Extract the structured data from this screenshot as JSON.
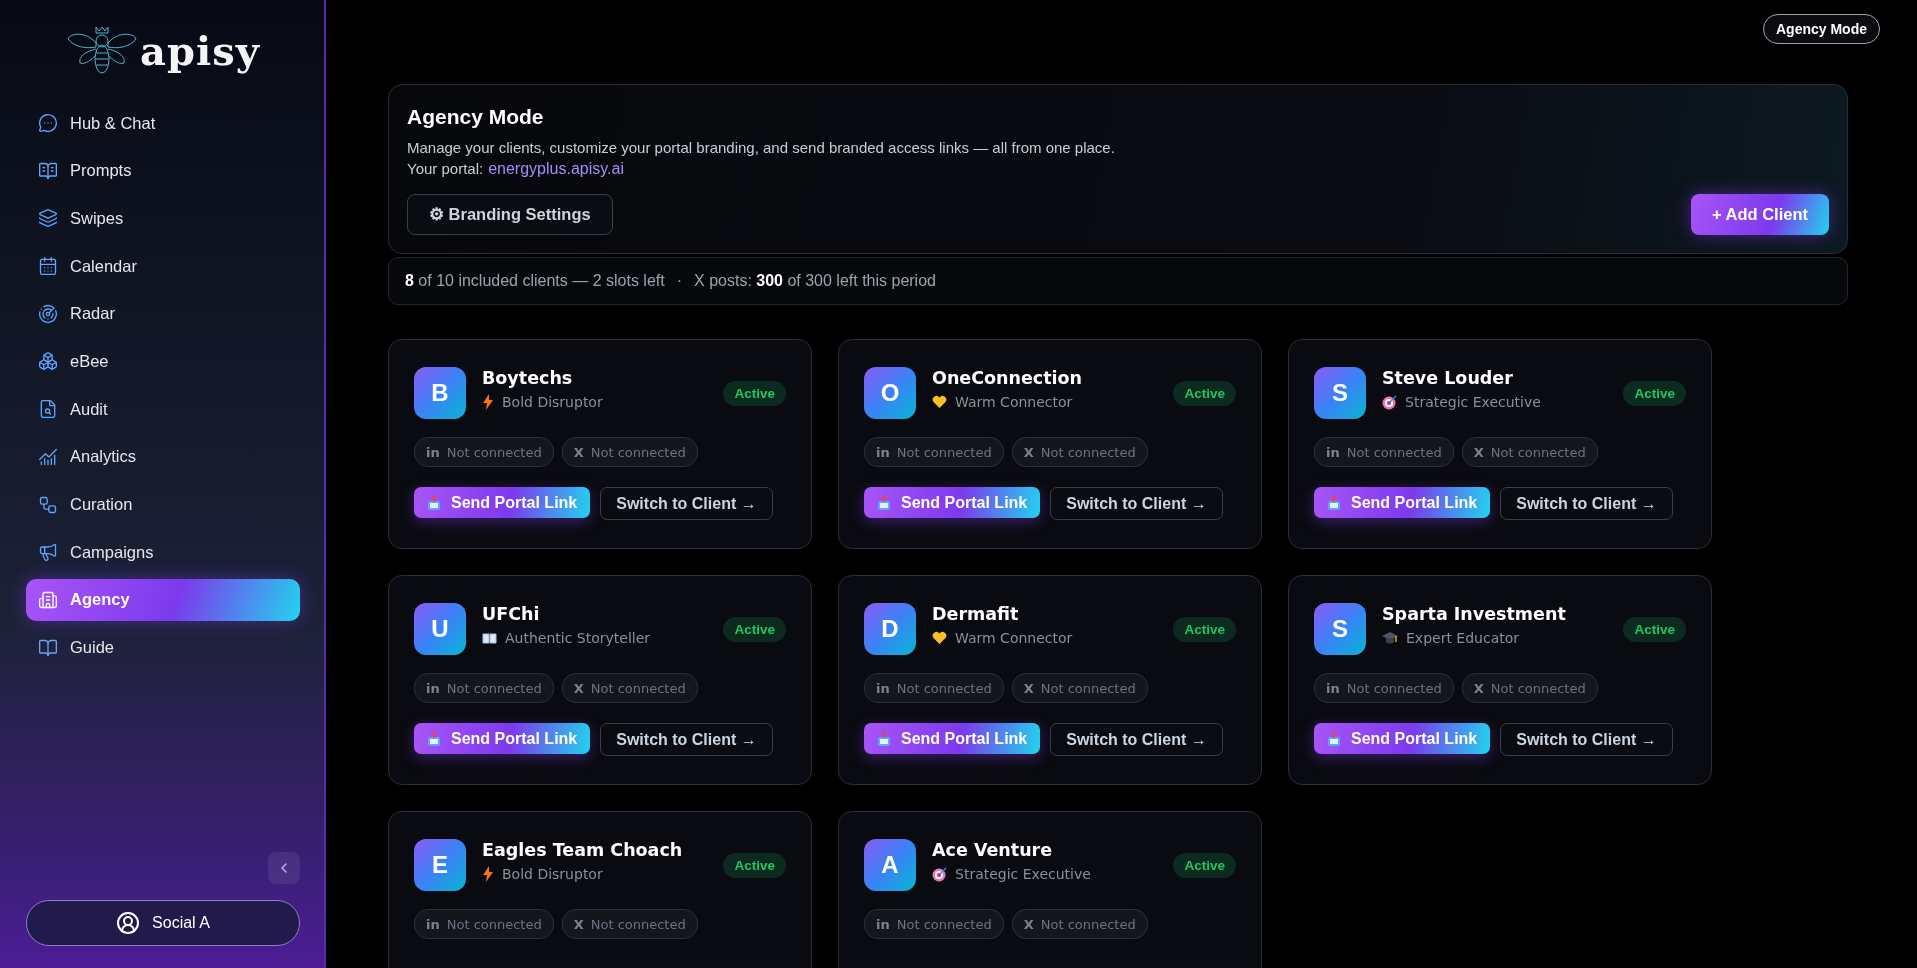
{
  "sidebar": {
    "logo_text": "apisy",
    "items": [
      {
        "label": "Hub & Chat",
        "selected": false
      },
      {
        "label": "Prompts",
        "selected": false
      },
      {
        "label": "Swipes",
        "selected": false
      },
      {
        "label": "Calendar",
        "selected": false
      },
      {
        "label": "Radar",
        "selected": false
      },
      {
        "label": "eBee",
        "selected": false
      },
      {
        "label": "Audit",
        "selected": false
      },
      {
        "label": "Analytics",
        "selected": false
      },
      {
        "label": "Curation",
        "selected": false
      },
      {
        "label": "Campaigns",
        "selected": false
      },
      {
        "label": "Agency",
        "selected": true
      },
      {
        "label": "Guide",
        "selected": false
      }
    ],
    "account": "Social A"
  },
  "top_bar": {
    "mode_badge": "Agency Mode"
  },
  "header": {
    "title": "Agency Mode",
    "description": "Manage your clients, customize your portal branding, and send branded access links — all from one place.",
    "portal_label": "Your portal:",
    "portal_link": "energyplus.apisy.ai",
    "branding_button": "⚙ Branding Settings",
    "add_button": "+ Add Client"
  },
  "usage": {
    "clients": "**8** of 10 included clients — 2 slots left",
    "separator": "·",
    "posts": "X posts: **300** of 300 left this period"
  },
  "clients": [
    {
      "initial": "B",
      "name": "Boytechs",
      "persona": "Bold Disruptor",
      "kind": "bolt",
      "status": "Active",
      "chips": [
        {
          "mark": "in",
          "label": "Not connected"
        },
        {
          "mark": "X",
          "label": "Not connected"
        }
      ],
      "send_label": "Send Portal Link",
      "switch_label": "Switch to Client →"
    },
    {
      "initial": "O",
      "name": "OneConnection",
      "persona": "Warm Connector",
      "kind": "heart",
      "status": "Active",
      "chips": [
        {
          "mark": "in",
          "label": "Not connected"
        },
        {
          "mark": "X",
          "label": "Not connected"
        }
      ],
      "send_label": "Send Portal Link",
      "switch_label": "Switch to Client →"
    },
    {
      "initial": "S",
      "name": "Steve Louder",
      "persona": "Strategic Executive",
      "kind": "target",
      "status": "Active",
      "chips": [
        {
          "mark": "in",
          "label": "Not connected"
        },
        {
          "mark": "X",
          "label": "Not connected"
        }
      ],
      "send_label": "Send Portal Link",
      "switch_label": "Switch to Client →"
    },
    {
      "initial": "U",
      "name": "UFChi",
      "persona": "Authentic Storyteller",
      "kind": "book",
      "status": "Active",
      "chips": [
        {
          "mark": "in",
          "label": "Not connected"
        },
        {
          "mark": "X",
          "label": "Not connected"
        }
      ],
      "send_label": "Send Portal Link",
      "switch_label": "Switch to Client →"
    },
    {
      "initial": "D",
      "name": "Dermafit",
      "persona": "Warm Connector",
      "kind": "heart",
      "status": "Active",
      "chips": [
        {
          "mark": "in",
          "label": "Not connected"
        },
        {
          "mark": "X",
          "label": "Not connected"
        }
      ],
      "send_label": "Send Portal Link",
      "switch_label": "Switch to Client →"
    },
    {
      "initial": "S",
      "name": "Sparta Investment",
      "persona": "Expert Educator",
      "kind": "cap",
      "status": "Active",
      "chips": [
        {
          "mark": "in",
          "label": "Not connected"
        },
        {
          "mark": "X",
          "label": "Not connected"
        }
      ],
      "send_label": "Send Portal Link",
      "switch_label": "Switch to Client →"
    },
    {
      "initial": "E",
      "name": "Eagles Team Choach",
      "persona": "Bold Disruptor",
      "kind": "bolt",
      "status": "Active",
      "chips": [
        {
          "mark": "in",
          "label": "Not connected"
        },
        {
          "mark": "X",
          "label": "Not connected"
        }
      ]
    },
    {
      "initial": "A",
      "name": "Ace Venture",
      "persona": "Strategic Executive",
      "kind": "target",
      "status": "Active",
      "chips": [
        {
          "mark": "in",
          "label": "Not connected"
        },
        {
          "mark": "X",
          "label": "Not connected"
        }
      ]
    }
  ]
}
